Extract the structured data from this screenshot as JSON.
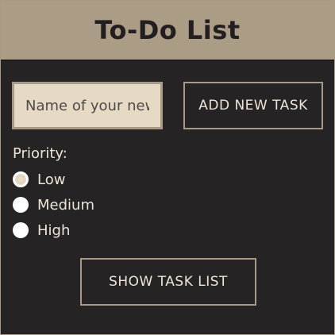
{
  "header": {
    "title": "To-Do List"
  },
  "task_input": {
    "value": "",
    "placeholder": "Name of your new task"
  },
  "add_button": {
    "label": "ADD NEW TASK"
  },
  "priority": {
    "label": "Priority:",
    "options": [
      {
        "label": "Low",
        "selected": true
      },
      {
        "label": "Medium",
        "selected": false
      },
      {
        "label": "High",
        "selected": false
      }
    ]
  },
  "show_button": {
    "label": "SHOW TASK LIST"
  },
  "colors": {
    "background": "#252324",
    "accent": "#ab9c85",
    "input_bg": "#e6dac4",
    "text": "#eee5d6"
  }
}
